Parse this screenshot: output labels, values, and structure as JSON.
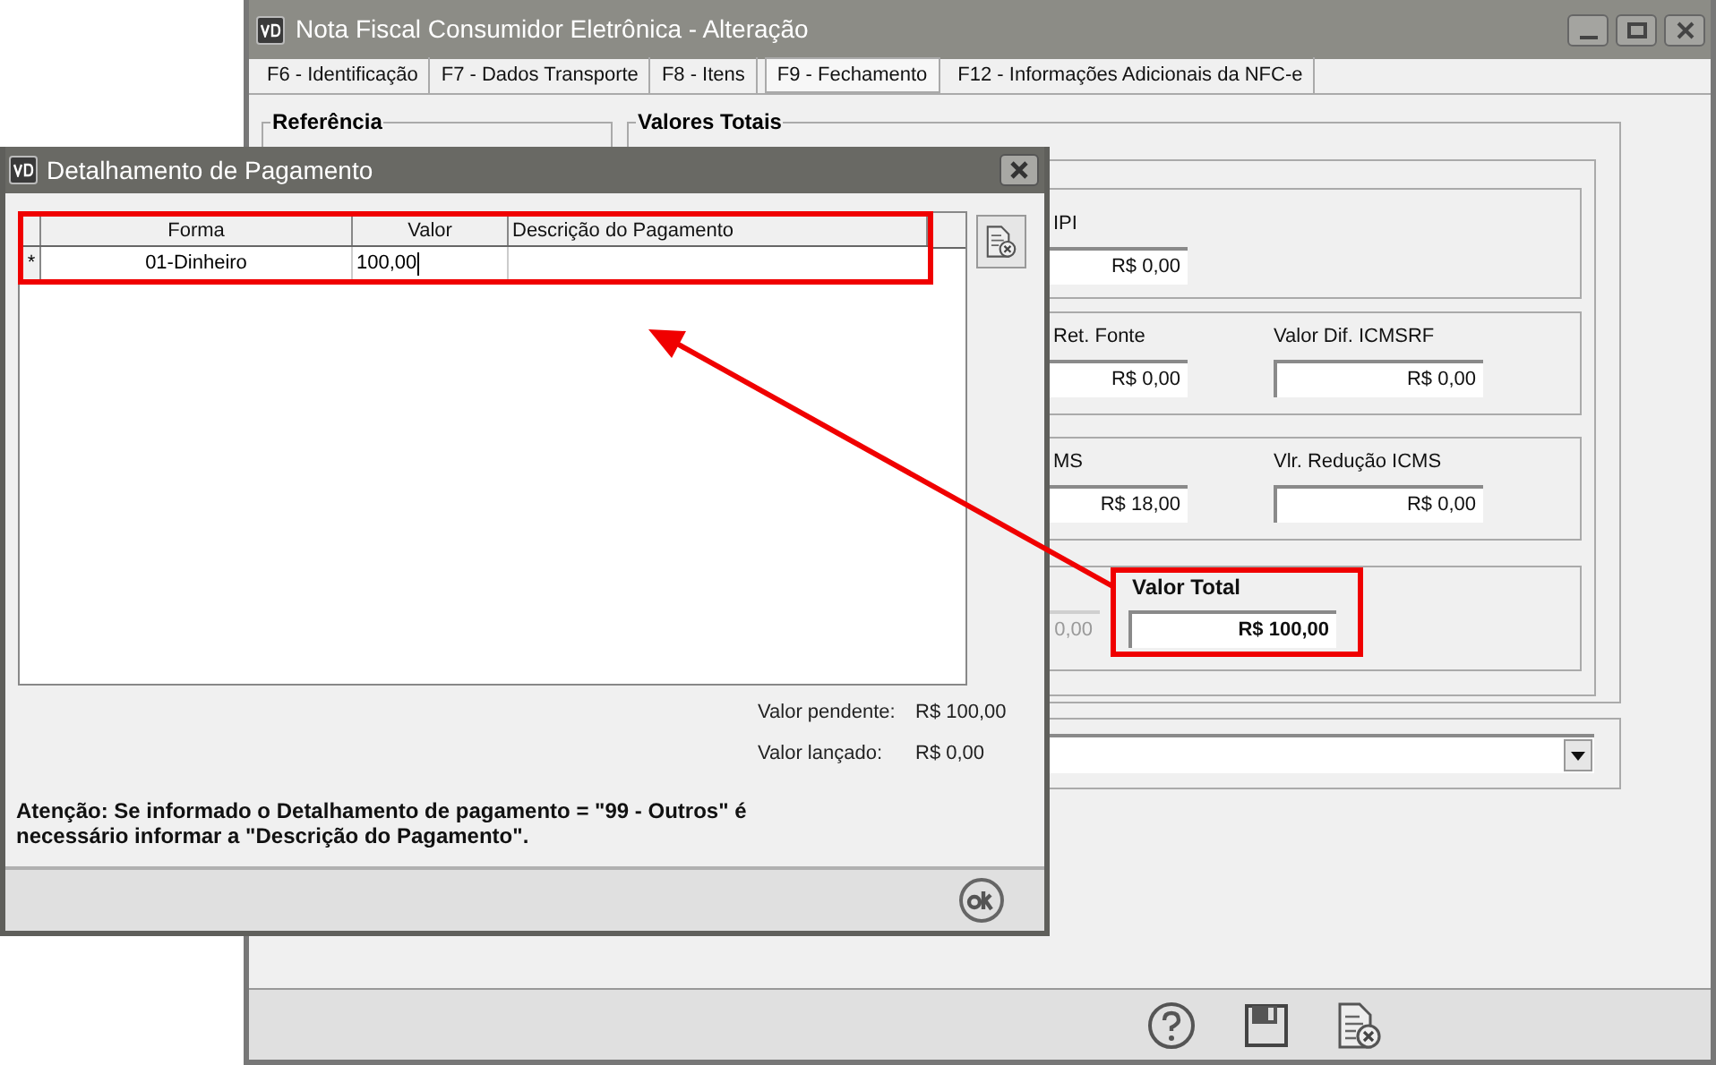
{
  "main_window": {
    "title": "Nota Fiscal Consumidor Eletrônica - Alteração",
    "tabs": [
      {
        "label": "F6 - Identificação",
        "selected": false
      },
      {
        "label": "F7 - Dados Transporte",
        "selected": false
      },
      {
        "label": "F8 - Itens",
        "selected": false
      },
      {
        "label": "F9 - Fechamento",
        "selected": true
      },
      {
        "label": "F12 - Informações Adicionais da NFC-e",
        "selected": false
      }
    ],
    "reference_group": {
      "title": "Referência"
    },
    "totals_group": {
      "title": "Valores Totais",
      "rows": [
        {
          "fields": [
            {
              "kind": "amount",
              "label": "IPI",
              "value": "R$ 0,00",
              "disabled": false
            }
          ]
        },
        {
          "fields": [
            {
              "kind": "amount",
              "label": "Ret. Fonte",
              "value": "R$ 0,00",
              "disabled": false
            },
            {
              "kind": "amount",
              "label": "Valor Dif. ICMSRF",
              "value": "R$ 0,00",
              "disabled": false
            }
          ]
        },
        {
          "fields": [
            {
              "kind": "amount",
              "label": "MS",
              "value": "R$ 18,00",
              "disabled": false
            },
            {
              "kind": "amount",
              "label": "Vlr. Redução ICMS",
              "value": "R$ 0,00",
              "disabled": false
            }
          ]
        },
        {
          "fields": [
            {
              "kind": "amount",
              "value": "0,00",
              "disabled": true
            },
            {
              "kind": "total",
              "label": "Valor Total",
              "value": "R$ 100,00",
              "disabled": false
            }
          ]
        }
      ]
    }
  },
  "dialog": {
    "title": "Detalhamento de Pagamento",
    "grid": {
      "columns": [
        "Forma",
        "Valor",
        "Descrição do Pagamento"
      ],
      "rows": [
        {
          "marker": "*",
          "forma": "01-Dinheiro",
          "valor": "100,00"
        }
      ]
    },
    "summary": [
      {
        "label": "Valor pendente:",
        "value": "R$ 100,00"
      },
      {
        "label": "Valor lançado:",
        "value": "R$ 0,00"
      }
    ],
    "note": "Atenção: Se informado o Detalhamento de pagamento = \"99 - Outros\" é\nnecessário informar a \"Descrição do Pagamento\"."
  }
}
